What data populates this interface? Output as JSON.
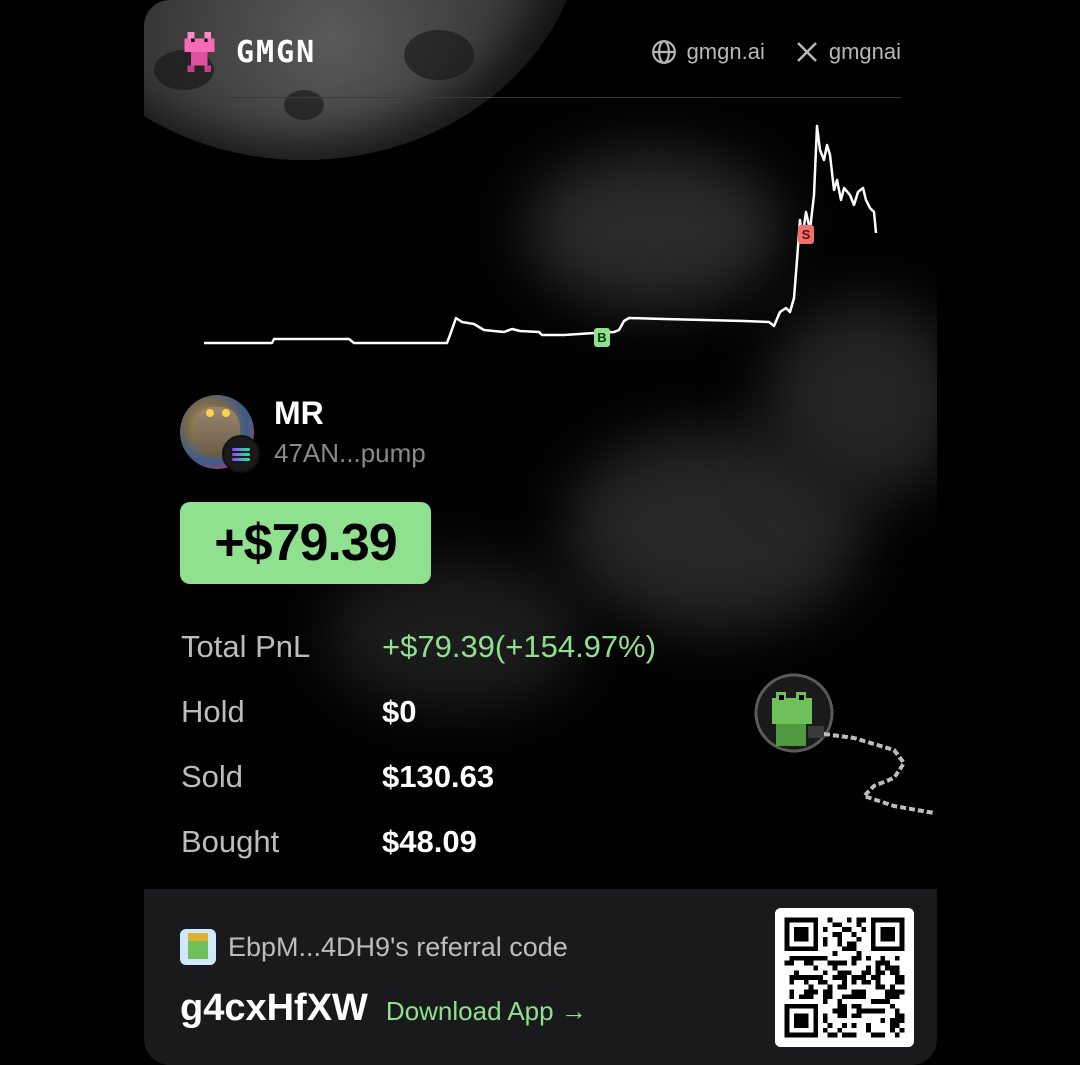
{
  "brand": {
    "name": "GMGN"
  },
  "links": [
    {
      "icon": "globe-icon",
      "label": "gmgn.ai"
    },
    {
      "icon": "x-logo-icon",
      "label": "gmgnai"
    }
  ],
  "chart_data": {
    "type": "line",
    "markers": [
      {
        "label": "B",
        "color": "#8fe08f"
      },
      {
        "label": "S",
        "color": "#f07070"
      }
    ]
  },
  "token": {
    "name": "MR",
    "address": "47AN...pump"
  },
  "pnl_amount": "+$79.39",
  "stats": [
    {
      "label": "Total PnL",
      "value": "+$79.39(+154.97%)"
    },
    {
      "label": "Hold",
      "value": "$0"
    },
    {
      "label": "Sold",
      "value": "$130.63"
    },
    {
      "label": "Bought",
      "value": "$48.09"
    }
  ],
  "footer": {
    "referral_text": "EbpM...4DH9's referral code",
    "code": "g4cxHfXW",
    "download_label": "Download App →"
  },
  "colors": {
    "accent_green": "#8fe08f",
    "sell_red": "#f07070",
    "footer_bg": "#1a1a1c"
  }
}
